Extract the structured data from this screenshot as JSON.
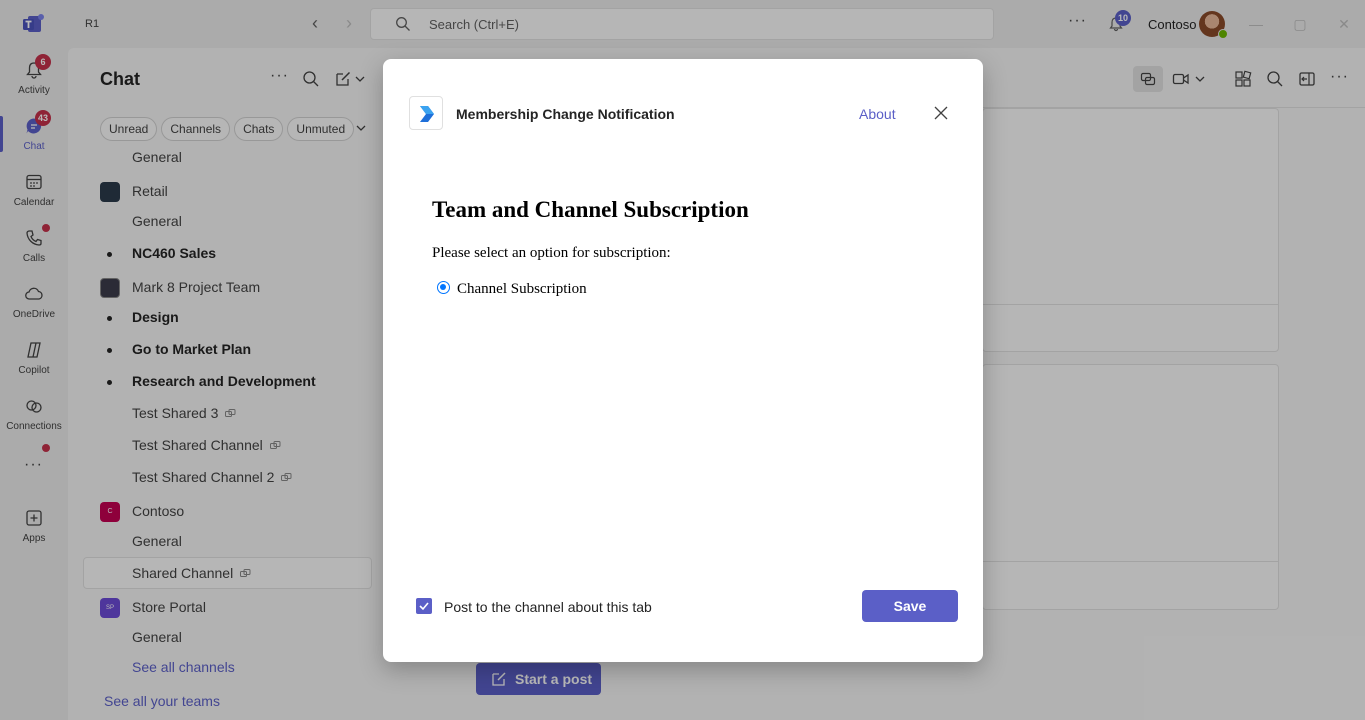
{
  "titlebar": {
    "tenant": "R1",
    "search_placeholder": "Search (Ctrl+E)",
    "notif_count": "10",
    "org_name": "Contoso"
  },
  "rail": [
    {
      "label": "Activity",
      "icon": "bell-icon",
      "badge": "6"
    },
    {
      "label": "Chat",
      "icon": "chat-icon",
      "badge": "43",
      "active": true
    },
    {
      "label": "Calendar",
      "icon": "calendar-icon"
    },
    {
      "label": "Calls",
      "icon": "phone-icon",
      "dot": true
    },
    {
      "label": "OneDrive",
      "icon": "cloud-icon"
    },
    {
      "label": "Copilot",
      "icon": "copilot-icon"
    },
    {
      "label": "Connections",
      "icon": "connections-icon"
    },
    {
      "label": "",
      "icon": "more-icon",
      "dot": true
    },
    {
      "label": "Apps",
      "icon": "add-apps-icon"
    }
  ],
  "listpane": {
    "title": "Chat",
    "filters": [
      "Unread",
      "Channels",
      "Chats",
      "Unmuted"
    ],
    "rows": [
      {
        "text": "General",
        "type": "channel"
      },
      {
        "text": "Retail",
        "type": "team",
        "color": "#2b3a4a"
      },
      {
        "text": "General",
        "type": "channel"
      },
      {
        "text": "NC460 Sales",
        "type": "bold"
      },
      {
        "text": "Mark 8 Project Team",
        "type": "team",
        "color": "#3b3b4a"
      },
      {
        "text": "Design",
        "type": "bold"
      },
      {
        "text": "Go to Market Plan",
        "type": "bold"
      },
      {
        "text": "Research and Development",
        "type": "bold"
      },
      {
        "text": "Test Shared 3",
        "type": "shared"
      },
      {
        "text": "Test Shared Channel",
        "type": "shared"
      },
      {
        "text": "Test Shared Channel 2",
        "type": "shared"
      },
      {
        "text": "Contoso",
        "type": "team",
        "color": "#c30052",
        "initial": "C"
      },
      {
        "text": "General",
        "type": "channel"
      },
      {
        "text": "Shared Channel",
        "type": "shared",
        "selected": true
      },
      {
        "text": "Store Portal",
        "type": "team",
        "color": "#6b4bd6",
        "initial": "SP"
      },
      {
        "text": "General",
        "type": "channel"
      },
      {
        "text": "See all channels",
        "type": "link"
      }
    ],
    "see_all_teams": "See all your teams"
  },
  "main": {
    "start_post": "Start a post"
  },
  "dialog": {
    "app_name": "Membership Change Notification",
    "about": "About",
    "heading": "Team and Channel Subscription",
    "prompt": "Please select an option for subscription:",
    "option": "Channel Subscription",
    "post_label": "Post to the channel about this tab",
    "save": "Save"
  },
  "colors": {
    "brand": "#5b5fc7",
    "badge": "#c4314b",
    "radio": "#0075ff"
  }
}
